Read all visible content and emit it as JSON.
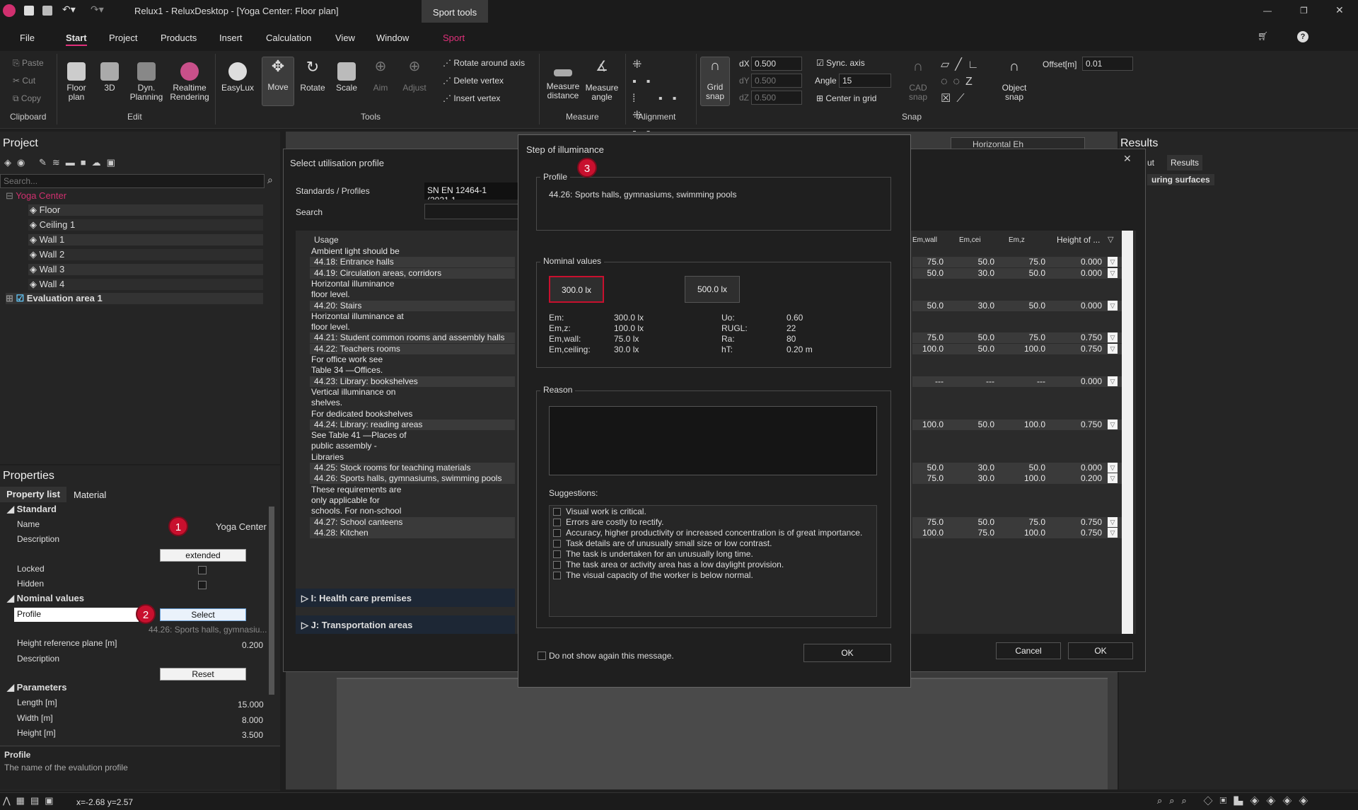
{
  "window": {
    "title": "Relux1 - ReluxDesktop - [Yoga Center: Floor plan]",
    "context_tab": "Sport tools"
  },
  "menu": [
    "File",
    "Start",
    "Project",
    "Products",
    "Insert",
    "Calculation",
    "View",
    "Window",
    "Sport"
  ],
  "ribbon": {
    "clipboard": {
      "paste": "Paste",
      "cut": "Cut",
      "copy": "Copy",
      "group": "Clipboard"
    },
    "edit": {
      "floor_plan": "Floor plan",
      "3d": "3D",
      "dyn": "Dyn. Planning",
      "realtime": "Realtime Rendering",
      "group": "Edit"
    },
    "tools": {
      "easylux": "EasyLux",
      "move": "Move",
      "rotate": "Rotate",
      "scale": "Scale",
      "aim": "Aim",
      "adjust": "Adjust",
      "rotate_axis": "Rotate around axis",
      "delete_vertex": "Delete vertex",
      "insert_vertex": "Insert vertex",
      "group": "Tools"
    },
    "measure": {
      "distance": "Measure distance",
      "angle": "Measure angle",
      "group": "Measure"
    },
    "alignment": {
      "group": "Alignment"
    },
    "snap": {
      "grid": "Grid snap",
      "dx_label": "dX",
      "dx": "0.500",
      "dy_label": "dY",
      "dy": "0.500",
      "dz_label": "dZ",
      "dz": "0.500",
      "sync": "Sync. axis",
      "angle_label": "Angle",
      "angle": "15",
      "center": "Center in grid",
      "cad": "CAD snap",
      "object": "Object snap",
      "offset_label": "Offset[m]",
      "offset": "0.01",
      "group": "Snap"
    }
  },
  "project": {
    "title": "Project",
    "search": "Search...",
    "root": "Yoga Center",
    "items": [
      "Floor",
      "Ceiling 1",
      "Wall 1",
      "Wall 2",
      "Wall 3",
      "Wall 4"
    ],
    "eval": "Evaluation area 1"
  },
  "properties": {
    "title": "Properties",
    "tabs": [
      "Property list",
      "Material"
    ],
    "standard": "Standard",
    "name_label": "Name",
    "name": "Yoga Center",
    "desc_label": "Description",
    "extended": "extended",
    "locked": "Locked",
    "hidden": "Hidden",
    "nominal": "Nominal values",
    "profile_label": "Profile",
    "select": "Select",
    "profile_value": "44.26: Sports halls, gymnasiu...",
    "href_label": "Height reference plane [m]",
    "href": "0.200",
    "desc2_label": "Description",
    "reset": "Reset",
    "parameters": "Parameters",
    "length_label": "Length [m]",
    "length": "15.000",
    "width_label": "Width [m]",
    "width": "8.000",
    "height_label": "Height [m]",
    "height": "3.500",
    "help_title": "Profile",
    "help_text": "The name of the evalution profile"
  },
  "results": {
    "title": "Results",
    "tab_partial": "ut",
    "tab": "Results",
    "sub": "uring surfaces",
    "combo": "Horizontal Eh"
  },
  "util_dialog": {
    "title": "Select utilisation profile",
    "std_label": "Standards / Profiles",
    "std_value": "SN EN 12464-1 (2021.1",
    "search_label": "Search",
    "col_usage": "Usage",
    "cols": [
      "Em,wall",
      "Em,cei",
      "Em,z",
      "Height of ..."
    ],
    "rows": [
      {
        "text": "Ambient light should be",
        "vals": [
          "",
          "",
          "",
          ""
        ]
      },
      {
        "text": "44.18: Entrance halls",
        "vals": [
          "75.0",
          "50.0",
          "75.0",
          "0.000"
        ]
      },
      {
        "text": "44.19: Circulation areas, corridors",
        "vals": [
          "50.0",
          "30.0",
          "50.0",
          "0.000"
        ]
      },
      {
        "text": "Horizontal illuminance",
        "vals": [
          "",
          "",
          "",
          ""
        ]
      },
      {
        "text": "floor level.",
        "vals": [
          "",
          "",
          "",
          ""
        ]
      },
      {
        "text": "44.20: Stairs",
        "vals": [
          "50.0",
          "30.0",
          "50.0",
          "0.000"
        ]
      },
      {
        "text": "Horizontal illuminance at",
        "vals": [
          "",
          "",
          "",
          ""
        ]
      },
      {
        "text": "floor level.",
        "vals": [
          "",
          "",
          "",
          ""
        ]
      },
      {
        "text": "44.21: Student common rooms and assembly halls",
        "vals": [
          "75.0",
          "50.0",
          "75.0",
          "0.750"
        ]
      },
      {
        "text": "44.22: Teachers rooms",
        "vals": [
          "100.0",
          "50.0",
          "100.0",
          "0.750"
        ]
      },
      {
        "text": "For office work see",
        "vals": [
          "",
          "",
          "",
          ""
        ]
      },
      {
        "text": "Table 34 —Offices.",
        "vals": [
          "",
          "",
          "",
          ""
        ]
      },
      {
        "text": "44.23: Library: bookshelves",
        "vals": [
          "---",
          "---",
          "---",
          "0.000"
        ]
      },
      {
        "text": "Vertical illuminance on",
        "vals": [
          "",
          "",
          "",
          ""
        ]
      },
      {
        "text": "shelves.",
        "vals": [
          "",
          "",
          "",
          ""
        ]
      },
      {
        "text": "For dedicated bookshelves",
        "vals": [
          "",
          "",
          "",
          ""
        ]
      },
      {
        "text": "44.24: Library: reading areas",
        "vals": [
          "100.0",
          "50.0",
          "100.0",
          "0.750"
        ]
      },
      {
        "text": "See Table 41 —Places of",
        "vals": [
          "",
          "",
          "",
          ""
        ]
      },
      {
        "text": "public assembly -",
        "vals": [
          "",
          "",
          "",
          ""
        ]
      },
      {
        "text": "Libraries",
        "vals": [
          "",
          "",
          "",
          ""
        ]
      },
      {
        "text": "44.25: Stock rooms for teaching materials",
        "vals": [
          "50.0",
          "30.0",
          "50.0",
          "0.000"
        ]
      },
      {
        "text": "44.26: Sports halls, gymnasiums, swimming pools",
        "vals": [
          "75.0",
          "30.0",
          "100.0",
          "0.200"
        ]
      },
      {
        "text": "These requirements are",
        "vals": [
          "",
          "",
          "",
          ""
        ]
      },
      {
        "text": "only applicable for",
        "vals": [
          "",
          "",
          "",
          ""
        ]
      },
      {
        "text": "schools. For non-school",
        "vals": [
          "",
          "",
          "",
          ""
        ]
      },
      {
        "text": "44.27: School canteens",
        "vals": [
          "75.0",
          "50.0",
          "75.0",
          "0.750"
        ]
      },
      {
        "text": "44.28: Kitchen",
        "vals": [
          "100.0",
          "75.0",
          "100.0",
          "0.750"
        ]
      }
    ],
    "group_i": "I: Health care premises",
    "group_j": "J: Transportation areas",
    "cancel": "Cancel",
    "ok": "OK"
  },
  "step_dialog": {
    "title": "Step of illuminance",
    "profile_group": "Profile",
    "profile": "44.26: Sports halls, gymnasiums, swimming pools",
    "nominal_group": "Nominal values",
    "btn1": "300.0 lx",
    "btn2": "500.0 lx",
    "vals_left": [
      [
        "Em:",
        "300.0 lx"
      ],
      [
        "Em,z:",
        "100.0 lx"
      ],
      [
        "Em,wall:",
        "75.0 lx"
      ],
      [
        "Em,ceiling:",
        "30.0 lx"
      ]
    ],
    "vals_right": [
      [
        "Uo:",
        "0.60"
      ],
      [
        "RUGL:",
        "22"
      ],
      [
        "Ra:",
        "80"
      ],
      [
        "hT:",
        "0.20 m"
      ]
    ],
    "reason_group": "Reason",
    "suggestions_label": "Suggestions:",
    "suggestions": [
      "Visual work is critical.",
      "Errors are costly to rectify.",
      "Accuracy, higher productivity or increased concentration is of great importance.",
      "Task details are of unusually small size or low contrast.",
      "The task is undertaken for an unusually long time.",
      "The task area or activity area has a low daylight provision.",
      "The visual capacity of the worker is below normal."
    ],
    "dont_show": "Do not show again this message.",
    "ok": "OK"
  },
  "badges": [
    "1",
    "2",
    "3"
  ],
  "statusbar": {
    "coords": "x=-2.68 y=2.57"
  },
  "colors": {
    "accent": "#c8102e",
    "sport": "#e0307a",
    "root": "#d0306f"
  }
}
